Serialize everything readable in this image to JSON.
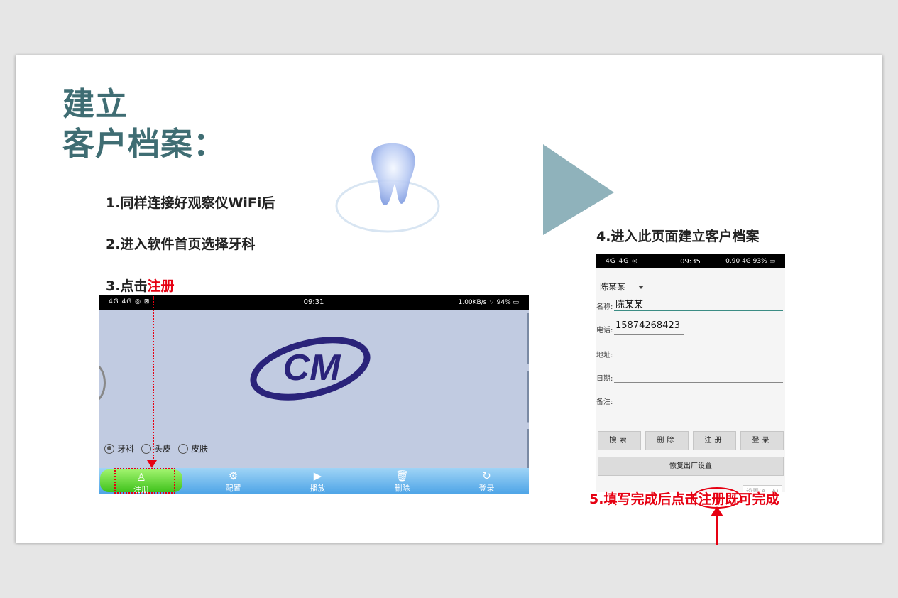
{
  "title": {
    "line1": "建立",
    "line2": "客户档案："
  },
  "steps": {
    "s1": "1.同样连接好观察仪WiFi后",
    "s2": "2.进入软件首页选择牙科",
    "s3_prefix": "3.点击",
    "s3_highlight": "注册",
    "s4": "4.进入此页面建立客户档案",
    "s5": "5.填写完成后点击注册既可完成"
  },
  "phone1": {
    "status": {
      "left": "4G 4G ◎ ⊠",
      "time": "09:31",
      "right": "1.00KB/s ⌔ 94% ▭"
    },
    "logo_text": "CM",
    "radios": [
      {
        "label": "牙科",
        "checked": true
      },
      {
        "label": "头皮",
        "checked": false
      },
      {
        "label": "皮肤",
        "checked": false
      }
    ],
    "nav": [
      {
        "icon": "user-icon",
        "glyph": "♙",
        "label": "注册"
      },
      {
        "icon": "gear-icon",
        "glyph": "⚙",
        "label": "配置"
      },
      {
        "icon": "play-icon",
        "glyph": "▶",
        "label": "播放"
      },
      {
        "icon": "trash-icon",
        "glyph": "🗑",
        "label": "删除"
      },
      {
        "icon": "refresh-icon",
        "glyph": "↻",
        "label": "登录"
      }
    ]
  },
  "phone2": {
    "status": {
      "left": "4G 4G ◎",
      "time": "09:35",
      "right": "0.90 4G 93% ▭"
    },
    "dropdown_value": "陈某某",
    "fields": [
      {
        "label": "名称:",
        "value": "陈某某"
      },
      {
        "label": "电话:",
        "value": "15874268423"
      },
      {
        "label": "地址:",
        "value": ""
      },
      {
        "label": "日期:",
        "value": ""
      },
      {
        "label": "备注:",
        "value": ""
      }
    ],
    "buttons": {
      "search": "搜索",
      "delete": "删除",
      "register": "注册",
      "login": "登录",
      "reset": "恢复出厂设置"
    },
    "ghost_text": "设置(A...A)"
  },
  "colors": {
    "title": "#3f6d73",
    "highlight": "#e60012",
    "triangle": "#8fb2bb"
  }
}
